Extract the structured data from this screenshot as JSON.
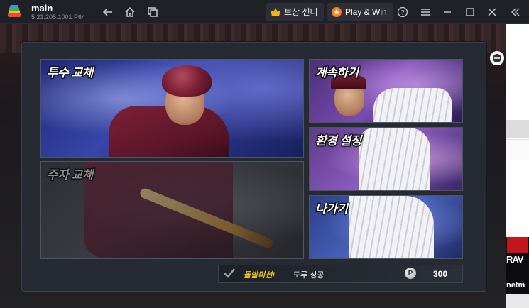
{
  "titlebar": {
    "app_name": "main",
    "app_version": "5.21.205.1001  P64",
    "reward_center_label": "보상 센터",
    "play_win_label": "Play & Win"
  },
  "menu": {
    "pitcher_change": "투수 교체",
    "batter_change": "주자 교체",
    "continue": "계속하기",
    "settings": "환경 설정",
    "exit": "나가기"
  },
  "mission": {
    "title": "돌발미션!",
    "description": "도루 성공",
    "coin_symbol": "P",
    "reward": "300"
  },
  "ad": {
    "brand_top": "RAV",
    "brand_bottom": "netm"
  },
  "colors": {
    "mission_accent": "#f3c41b",
    "titlebar_bg": "#1f2126",
    "panel_bg": "#262b33"
  },
  "icons": [
    "back-icon",
    "home-icon",
    "windows-icon",
    "crown-icon",
    "play-win-icon",
    "help-icon",
    "menu-icon",
    "minimize-icon",
    "maximize-icon",
    "close-icon",
    "collapse-icon",
    "chat-icon",
    "check-icon"
  ]
}
